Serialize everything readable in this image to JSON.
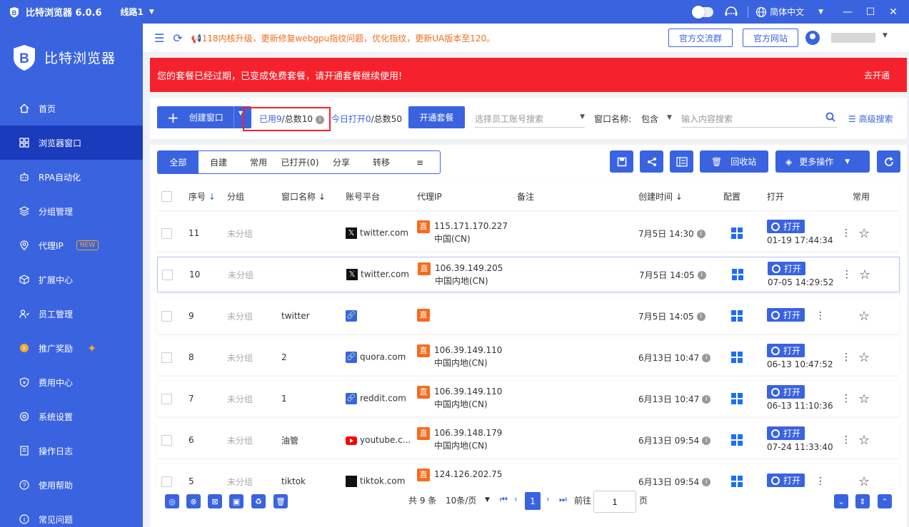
{
  "titlebar": {
    "app_name": "比特浏览器 6.0.6",
    "line": "线路1",
    "language": "简体中文",
    "minimize": "—",
    "maximize": "☐",
    "close": "✕"
  },
  "sidebar": {
    "brand": "比特浏览器",
    "items": [
      {
        "label": "首页",
        "icon": "home-icon"
      },
      {
        "label": "浏览器窗口",
        "icon": "grid-icon"
      },
      {
        "label": "RPA自动化",
        "icon": "robot-icon"
      },
      {
        "label": "分组管理",
        "icon": "layers-icon"
      },
      {
        "label": "代理IP",
        "icon": "location-icon",
        "badge": "NEW"
      },
      {
        "label": "扩展中心",
        "icon": "cube-icon"
      },
      {
        "label": "员工管理",
        "icon": "users-icon"
      },
      {
        "label": "推广奖励",
        "icon": "coin-icon"
      },
      {
        "label": "费用中心",
        "icon": "shield-yen-icon"
      },
      {
        "label": "系统设置",
        "icon": "settings-icon"
      },
      {
        "label": "操作日志",
        "icon": "log-icon"
      },
      {
        "label": "使用帮助",
        "icon": "help-icon"
      },
      {
        "label": "常见问题",
        "icon": "info-icon"
      }
    ]
  },
  "topbar": {
    "notice": "118内核升级，更新修复webgpu指纹问题，优化指纹，更新UA版本至120。",
    "group_btn": "官方交流群",
    "site_btn": "官方网站"
  },
  "alert": {
    "message": "您的套餐已经过期，已变成免费套餐，请开通套餐继续使用!",
    "action": "去开通"
  },
  "toolbar": {
    "create": "创建窗口",
    "used_label": "已用",
    "used_value": "9",
    "total_label": "/总数10",
    "today_label": "今日打开0",
    "today_total": "/总数50",
    "open_plan": "开通套餐",
    "staff_placeholder": "选择员工账号搜索",
    "window_name_label": "窗口名称:",
    "match": "包含",
    "search_placeholder": "输入内容搜索",
    "advanced": "高级搜索"
  },
  "tabs": [
    "全部",
    "自建",
    "常用",
    "已打开(0)",
    "分享",
    "转移"
  ],
  "actions": {
    "recycle": "回收站",
    "more": "更多操作"
  },
  "columns": {
    "seq": "序号",
    "group": "分组",
    "name": "窗口名称",
    "platform": "账号平台",
    "proxy": "代理IP",
    "remark": "备注",
    "created": "创建时间",
    "config": "配置",
    "open": "打开",
    "common": "常用"
  },
  "rows": [
    {
      "seq": "11",
      "group": "未分组",
      "name": "",
      "platform": "twitter.com",
      "platform_icon": "x",
      "ip": "115.171.170.227",
      "region": "中国(CN)",
      "created": "7月5日 14:30",
      "opened": "01-19 17:44:34"
    },
    {
      "seq": "10",
      "group": "未分组",
      "name": "",
      "platform": "twitter.com",
      "platform_icon": "x",
      "ip": "106.39.149.205",
      "region": "中国内地(CN)",
      "created": "7月5日 14:05",
      "opened": "07-05 14:29:52"
    },
    {
      "seq": "9",
      "group": "未分组",
      "name": "twitter",
      "platform": "",
      "platform_icon": "link",
      "ip": "",
      "region": "",
      "created": "7月5日 14:05",
      "opened": ""
    },
    {
      "seq": "8",
      "group": "未分组",
      "name": "2",
      "platform": "quora.com",
      "platform_icon": "link",
      "ip": "106.39.149.110",
      "region": "中国内地(CN)",
      "created": "6月13日 10:47",
      "opened": "06-13 10:47:52"
    },
    {
      "seq": "7",
      "group": "未分组",
      "name": "1",
      "platform": "reddit.com",
      "platform_icon": "link",
      "ip": "106.39.149.110",
      "region": "中国内地(CN)",
      "created": "6月13日 10:47",
      "opened": "06-13 11:10:36"
    },
    {
      "seq": "6",
      "group": "未分组",
      "name": "油管",
      "platform": "youtube.c...",
      "platform_icon": "youtube",
      "ip": "106.39.148.179",
      "region": "中国内地(CN)",
      "created": "6月13日 09:54",
      "opened": "07-24 11:33:40"
    },
    {
      "seq": "5",
      "group": "未分组",
      "name": "tiktok",
      "platform": "tiktok.com",
      "platform_icon": "tiktok",
      "ip": "124.126.202.75",
      "region": "",
      "created": "6月13日 09:54",
      "opened": ""
    }
  ],
  "open_label": "打开",
  "proxy_tag": "直",
  "pagination": {
    "total": "共 9 条",
    "page_size": "10条/页",
    "current": "1",
    "goto_label": "前往",
    "goto_value": "1",
    "page_unit": "页"
  },
  "colors": {
    "primary": "#3a63e0",
    "alert": "#f5222d",
    "notice": "#f56c1d"
  }
}
